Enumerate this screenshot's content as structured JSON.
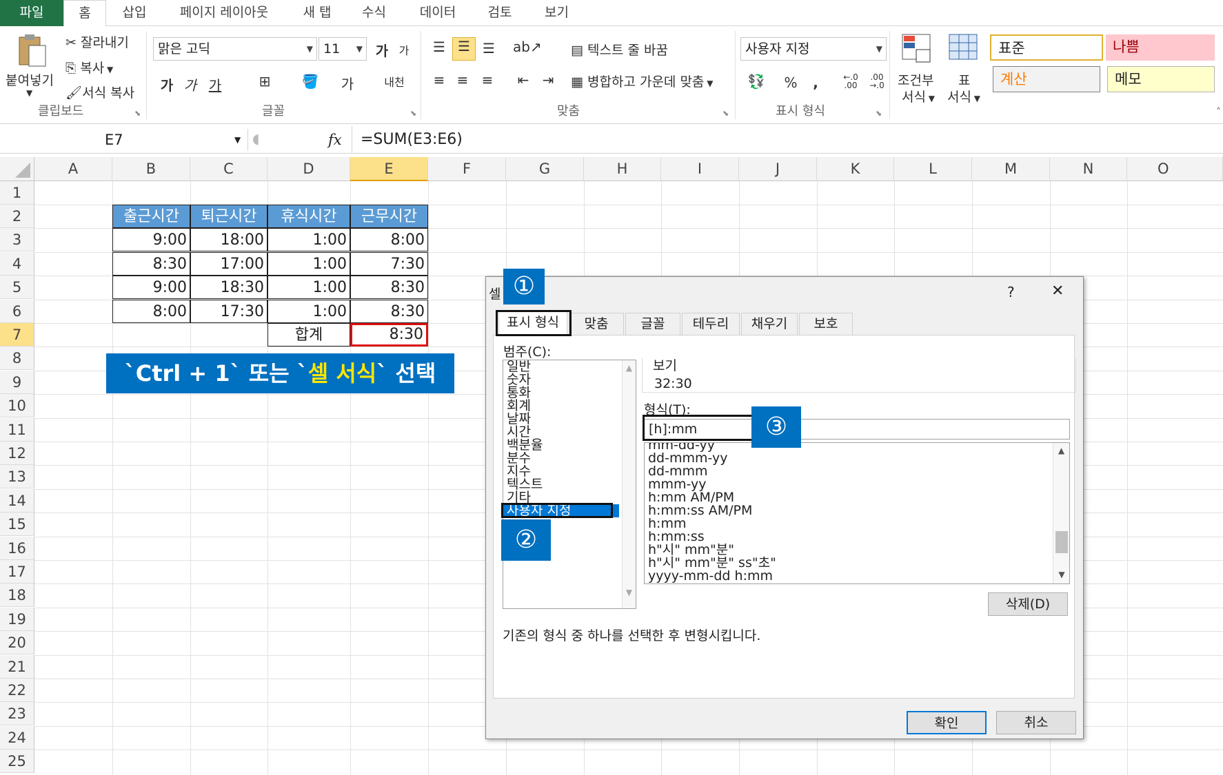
{
  "ribbon": {
    "tabs": [
      "파일",
      "홈",
      "삽입",
      "페이지 레이아웃",
      "새 탭",
      "수식",
      "데이터",
      "검토",
      "보기"
    ],
    "clipboard": {
      "paste": "붙여넣기",
      "cut": "잘라내기",
      "copy": "복사",
      "format_painter": "서식 복사",
      "group": "클립보드"
    },
    "font": {
      "name": "맑은 고딕",
      "size": "11",
      "grow": "가",
      "shrink": "가",
      "bold": "가",
      "italic": "가",
      "underline": "가",
      "color": "가",
      "phonetic": "내천",
      "group": "글꼴"
    },
    "align": {
      "wrap": "텍스트 줄 바꿈",
      "merge": "병합하고 가운데 맞춤",
      "group": "맞춤"
    },
    "number": {
      "format": "사용자 지정",
      "percent": "%",
      "comma": ",",
      "inc": "←.0\n.00",
      "dec": ".00\n→.0",
      "group": "표시 형식"
    },
    "styles": {
      "cond1": "조건부",
      "cond2": "서식",
      "table1": "표",
      "table2": "서식",
      "normal": "표준",
      "bad": "나쁨",
      "calc": "계산",
      "memo": "메모"
    },
    "colors": {
      "file_tab": "#217346",
      "bad_bg": "#ffc7ce",
      "bad_fg": "#9c0006",
      "calc_fg": "#fa7d00",
      "memo_bg": "#ffffcc",
      "header_bg": "#5b9bd5",
      "accent": "#0070c0"
    }
  },
  "formula_bar": {
    "name_box": "E7",
    "fx": "fx",
    "formula": "=SUM(E3:E6)"
  },
  "columns": [
    "A",
    "B",
    "C",
    "D",
    "E",
    "F",
    "G",
    "H",
    "I",
    "J",
    "K",
    "L",
    "M",
    "N",
    "O"
  ],
  "rows": [
    "1",
    "2",
    "3",
    "4",
    "5",
    "6",
    "7",
    "8",
    "9",
    "10",
    "11",
    "12",
    "13",
    "14",
    "15",
    "16",
    "17",
    "18",
    "19",
    "20",
    "21",
    "22",
    "23",
    "24",
    "25"
  ],
  "table": {
    "headers": [
      "출근시간",
      "퇴근시간",
      "휴식시간",
      "근무시간"
    ],
    "rows": [
      [
        "9:00",
        "18:00",
        "1:00",
        "8:00"
      ],
      [
        "8:30",
        "17:00",
        "1:00",
        "7:30"
      ],
      [
        "9:00",
        "18:30",
        "1:00",
        "8:30"
      ],
      [
        "8:00",
        "17:30",
        "1:00",
        "8:30"
      ]
    ],
    "total_label": "합계",
    "total_value": "8:30"
  },
  "banner": {
    "p1": "`Ctrl + 1` 또는 `",
    "p2": "셀 서식",
    "p3": "` 선택"
  },
  "dialog": {
    "title": "셀",
    "help": "?",
    "close": "✕",
    "tabs": [
      "표시 형식",
      "맞춤",
      "글꼴",
      "테두리",
      "채우기",
      "보호"
    ],
    "category_label": "범주(C):",
    "categories": [
      "일반",
      "숫자",
      "통화",
      "회계",
      "날짜",
      "시간",
      "백분율",
      "분수",
      "지수",
      "텍스트",
      "기타",
      "사용자 지정"
    ],
    "preview_label": "보기",
    "preview_value": "32:30",
    "type_label": "형식(T):",
    "type_value": "[h]:mm",
    "formats": [
      "mm-dd-yy",
      "dd-mmm-yy",
      "dd-mmm",
      "mmm-yy",
      "h:mm AM/PM",
      "h:mm:ss AM/PM",
      "h:mm",
      "h:mm:ss",
      "h\"시\" mm\"분\"",
      "h\"시\" mm\"분\" ss\"초\"",
      "yyyy-mm-dd h:mm"
    ],
    "delete": "삭제(D)",
    "description": "기존의 형식 중 하나를 선택한 후 변형시킵니다.",
    "ok": "확인",
    "cancel": "취소",
    "markers": [
      "①",
      "②",
      "③"
    ]
  }
}
